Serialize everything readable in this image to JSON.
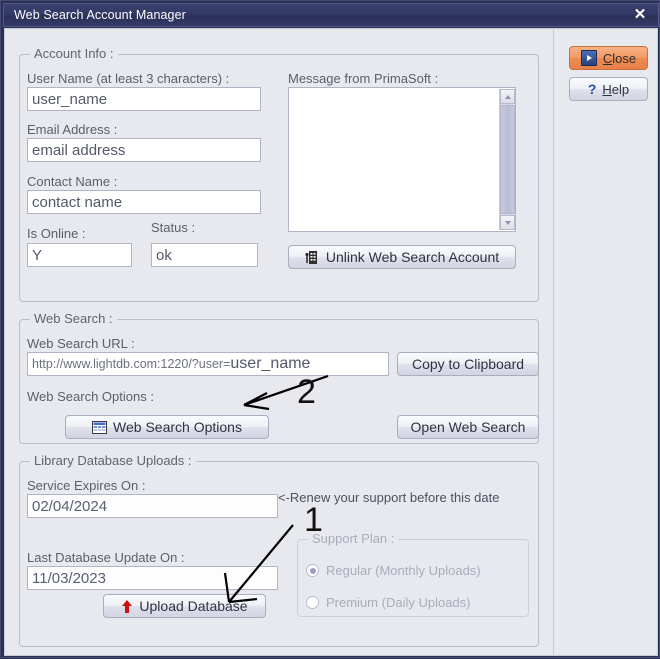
{
  "window": {
    "title": "Web Search Account Manager",
    "close_glyph": "✕"
  },
  "side_buttons": {
    "close": {
      "label_pre": "",
      "label_accel": "C",
      "label_post": "lose",
      "full": "Close",
      "icon": "arrow-right-icon"
    },
    "help": {
      "label_accel": "H",
      "label_post": "elp",
      "full": "Help",
      "icon": "question-mark-icon"
    }
  },
  "account_info": {
    "group_title": "Account Info :",
    "user_name_label": "User Name (at least 3 characters) :",
    "user_name_value": "user_name",
    "email_label": "Email Address :",
    "email_value": "email address",
    "contact_label": "Contact Name :",
    "contact_value": "contact name",
    "is_online_label": "Is Online :",
    "is_online_value": "Y",
    "status_label": "Status :",
    "status_value": "ok",
    "message_label": "Message from PrimaSoft :",
    "message_value": "",
    "unlink_button": "Unlink Web Search Account"
  },
  "web_search": {
    "group_title": "Web Search :",
    "url_label": "Web Search URL :",
    "url_prefix": "http://www.lightdb.com:1220/?user=",
    "url_user": "user_name",
    "copy_button": "Copy to Clipboard",
    "options_label": "Web Search Options :",
    "options_button": "Web Search Options",
    "open_button": "Open Web Search"
  },
  "library_uploads": {
    "group_title": "Library Database Uploads :",
    "expires_label": "Service Expires On :",
    "expires_value": "02/04/2024",
    "renew_note": "<-Renew your support before this date",
    "last_update_label": "Last Database Update On :",
    "last_update_value": "11/03/2023",
    "upload_button": "Upload Database",
    "support_plan": {
      "group_title": "Support Plan :",
      "options": [
        {
          "label": "Regular (Monthly Uploads)",
          "checked": true
        },
        {
          "label": "Premium (Daily Uploads)",
          "checked": false
        }
      ]
    }
  },
  "annotations": [
    {
      "number": "1",
      "target": "upload-database-button"
    },
    {
      "number": "2",
      "target": "web-search-options-button"
    }
  ],
  "colors": {
    "titlebar": "#333a66",
    "client_bg": "#e7e9ef",
    "accent_orange": "#ee8b53",
    "accent_blue": "#2451a8",
    "upload_arrow_red": "#cc1111"
  }
}
